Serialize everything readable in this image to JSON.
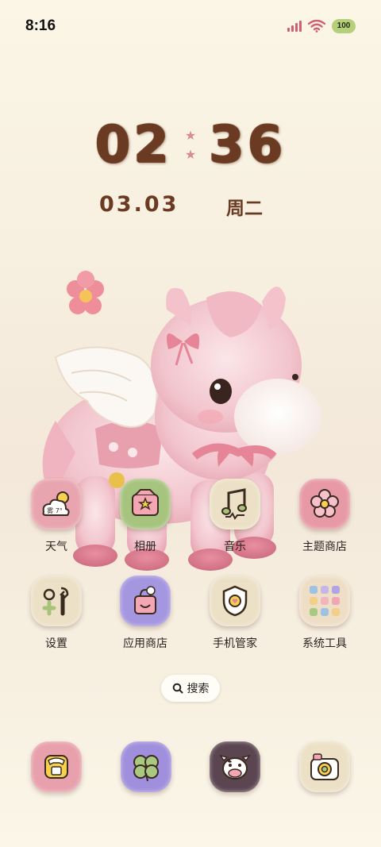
{
  "status_bar": {
    "time": "8:16",
    "battery": "100",
    "icons": [
      "signal-icon",
      "wifi-icon",
      "battery-icon"
    ]
  },
  "clock": {
    "hours": "02",
    "minutes": "36",
    "separator": "★",
    "date": "03.03",
    "weekday": "周二"
  },
  "apps": [
    {
      "label": "天气",
      "icon": "weather-icon",
      "tint": "#e8a5b0"
    },
    {
      "label": "相册",
      "icon": "gallery-icon",
      "tint": "#a6c47e"
    },
    {
      "label": "音乐",
      "icon": "music-icon",
      "tint": "#ece1c6"
    },
    {
      "label": "主题商店",
      "icon": "theme-store-icon",
      "tint": "#e79aa6"
    },
    {
      "label": "设置",
      "icon": "settings-icon",
      "tint": "#ece1c6"
    },
    {
      "label": "应用商店",
      "icon": "app-store-icon",
      "tint": "#a596e0"
    },
    {
      "label": "手机管家",
      "icon": "phone-manager-icon",
      "tint": "#ece1c6"
    },
    {
      "label": "系统工具",
      "icon": "system-tools-folder-icon",
      "tint": "#efdec6"
    }
  ],
  "weather_icon_text": "雾 7°",
  "search": {
    "label": "搜索",
    "icon": "search-icon"
  },
  "dock": [
    {
      "icon": "phone-icon",
      "tint": "#e8a0ac"
    },
    {
      "icon": "clover-messages-icon",
      "tint": "#a08fdc"
    },
    {
      "icon": "cow-contacts-icon",
      "tint": "#5a4550"
    },
    {
      "icon": "camera-icon",
      "tint": "#ece1c6"
    }
  ],
  "colors": {
    "clock": "#6b3a22",
    "accent_pink": "#e8a0ac",
    "background": "#f7efe0"
  }
}
